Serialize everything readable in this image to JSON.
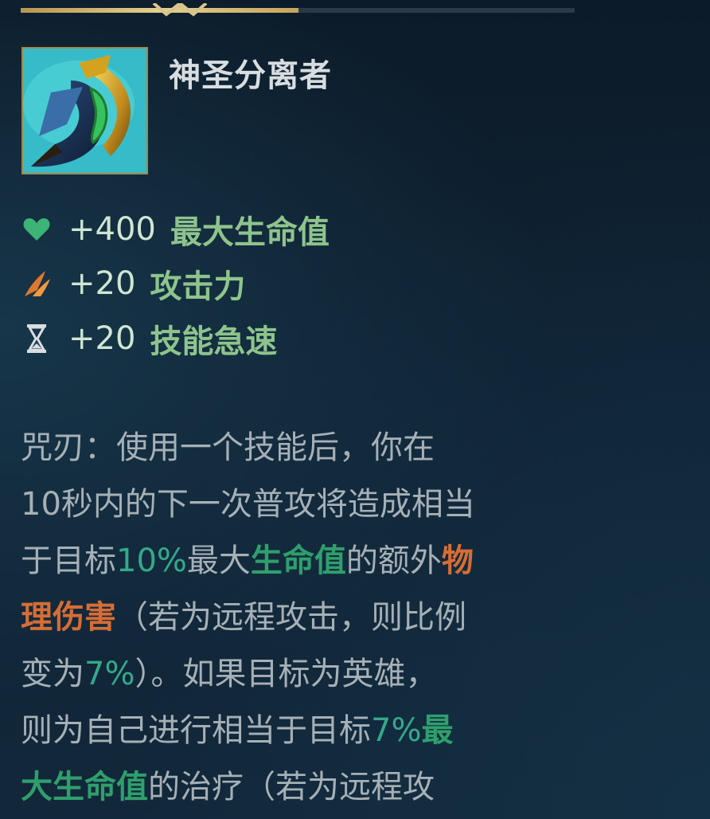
{
  "item": {
    "name": "神圣分离者",
    "icon": "divine-sunderer-item-icon"
  },
  "stats": [
    {
      "icon": "heart-icon",
      "value": "+400",
      "label": "最大生命值",
      "color": "#3bb476"
    },
    {
      "icon": "attack-damage-icon",
      "value": "+20",
      "label": "攻击力",
      "color": "#e0782c"
    },
    {
      "icon": "hourglass-icon",
      "value": "+20",
      "label": "技能急速",
      "color": "#d9dde0"
    }
  ],
  "description": {
    "line1": "咒刃：使用一个技能后，你在",
    "line2": "10秒内的下一次普攻将造成相当",
    "line3": {
      "a": "于目标",
      "b": "10%",
      "c": "最大",
      "d": "生命值",
      "e": "的额外",
      "f": "物"
    },
    "line4": {
      "a": "理伤害",
      "b": "（若为远程攻击，则比例"
    },
    "line5": {
      "a": "变为",
      "b": "7%",
      "c": "）。如果目标为英雄，"
    },
    "line6": {
      "a": "则为自己进行相当于目标",
      "b": "7%",
      "c": "最"
    },
    "line7": {
      "a": "大生命值",
      "b": "的治疗（若为远程攻"
    }
  },
  "colors": {
    "highlight_green": "#2f9f6c",
    "highlight_orange": "#d66d35",
    "body_text": "#a6b0b6",
    "top_bar_accent": "#e6cf8e"
  }
}
